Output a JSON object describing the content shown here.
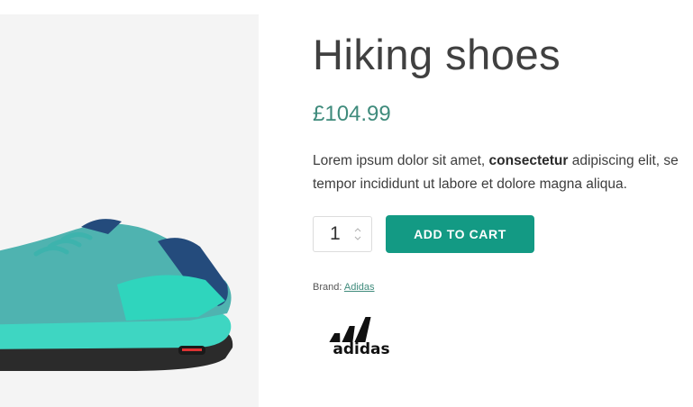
{
  "product": {
    "title": "Hiking shoes",
    "price": "£104.99",
    "description": {
      "part1": "Lorem ipsum dolor sit amet, ",
      "bold": "consectetur",
      "part2": " adipiscing elit, se",
      "line2": "tempor incididunt ut labore et dolore magna aliqua."
    },
    "quantity": "1",
    "add_to_cart_label": "ADD TO CART",
    "brand_label": "Brand:",
    "brand_name": "Adidas",
    "brand_logo_text": "adidas"
  },
  "colors": {
    "accent": "#139a84",
    "price": "#3f8b7c",
    "image_bg": "#f4f4f4"
  },
  "icons": [
    "shoe-image",
    "quantity-up-arrow-icon",
    "quantity-down-arrow-icon",
    "adidas-logo"
  ]
}
